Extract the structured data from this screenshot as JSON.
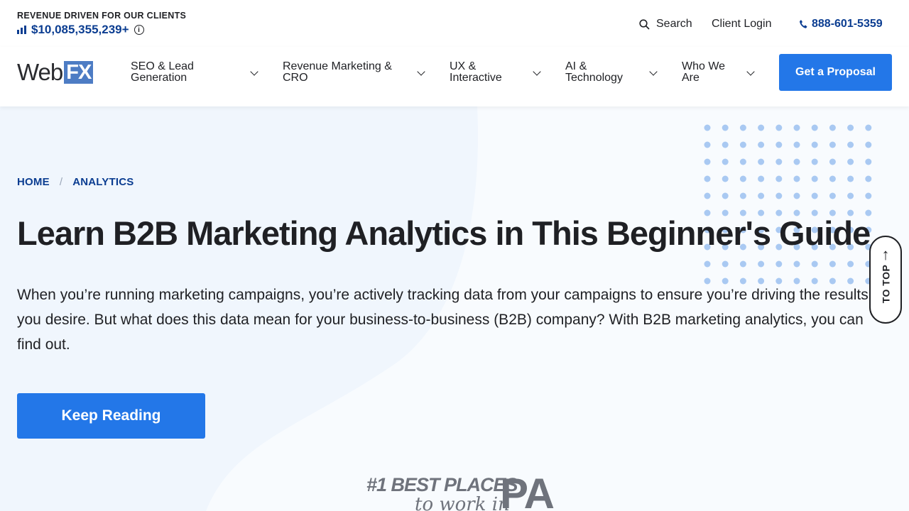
{
  "topbar": {
    "revenue_label": "REVENUE DRIVEN FOR OUR CLIENTS",
    "revenue_value": "$10,085,355,239+",
    "search_label": "Search",
    "login_label": "Client Login",
    "phone": "888-601-5359"
  },
  "logo": {
    "part1": "Web",
    "part2": "FX"
  },
  "nav": {
    "items": [
      {
        "label": "SEO & Lead Generation"
      },
      {
        "label": "Revenue Marketing & CRO"
      },
      {
        "label": "UX & Interactive"
      },
      {
        "label": "AI & Technology"
      },
      {
        "label": "Who We Are"
      }
    ],
    "cta_label": "Get a Proposal"
  },
  "breadcrumb": {
    "home": "HOME",
    "separator": "/",
    "current": "ANALYTICS"
  },
  "hero": {
    "title": "Learn B2B Marketing Analytics in This Beginner's Guide",
    "intro": "When you’re running marketing campaigns, you’re actively tracking data from your campaigns to ensure you’re driving the results you desire. But what does this data mean for your business-to-business (B2B) company? With B2B marketing analytics, you can find out.",
    "button_label": "Keep Reading"
  },
  "award": {
    "line1": "#1 BEST PLACES",
    "line2": "to work in",
    "state": "PA"
  },
  "totop": {
    "label": "TO TOP",
    "arrow": "↑"
  },
  "colors": {
    "brand_blue": "#2377e8",
    "dark_blue": "#0b3d91",
    "hero_bg": "#f0f6fd",
    "dots": "#a9c9f2"
  },
  "icons": [
    "bar-chart-icon",
    "info-icon",
    "search-icon",
    "phone-icon",
    "chevron-down-icon",
    "arrow-up-icon"
  ]
}
